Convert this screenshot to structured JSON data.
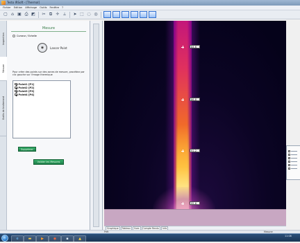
{
  "window": {
    "title": "Testo IRSoft - [Thermal]"
  },
  "menu": [
    "Fichier",
    "Edition",
    "Affichage",
    "Outils",
    "Fenêtre",
    "?"
  ],
  "toolbar": {
    "icons": [
      "new-icon",
      "open-icon",
      "save-icon",
      "print-icon",
      "image-icon",
      "cut-icon",
      "copy-icon",
      "crosshair-icon",
      "measure-icon",
      "arrow-icon",
      "area-icon",
      "hotspot-icon",
      "coldspot-icon",
      "palette-icon"
    ],
    "view_buttons": 6
  },
  "vertical_tabs": [
    "Inspection",
    "Mesure",
    "Outils de traitement"
  ],
  "panel": {
    "title": "Mesure",
    "radio_label": "Curseur / Echelle",
    "launch_label": "Lancer Point",
    "instructions": "Pour créer des points sur des zones de mesure, procédez par clic gauche sur l'image thermique",
    "points": [
      "Point1 [P1]",
      "Point2 [P2]",
      "Point3 [P3]",
      "Point4 [P4]"
    ],
    "button1": "Supprimer",
    "button2": "Valider les Mesures"
  },
  "markers": [
    {
      "label": "84,6"
    },
    {
      "label": "86,8"
    },
    {
      "label": "91,2"
    },
    {
      "label": "95,6"
    }
  ],
  "bottom_tabs": [
    "Graphique",
    "Tableau",
    "Vues",
    "Compte Rendu",
    "Info"
  ],
  "status": {
    "left": "Prêt",
    "right": "Mesurer"
  },
  "taskbar": {
    "clock_time": "11:08",
    "clock_date": "21/05/2013"
  },
  "colors": {
    "accent_green": "#2a9a5a",
    "pipe_hot": "#ffd23a",
    "pipe_cool": "#c3177a",
    "background_cold": "#06021a"
  }
}
